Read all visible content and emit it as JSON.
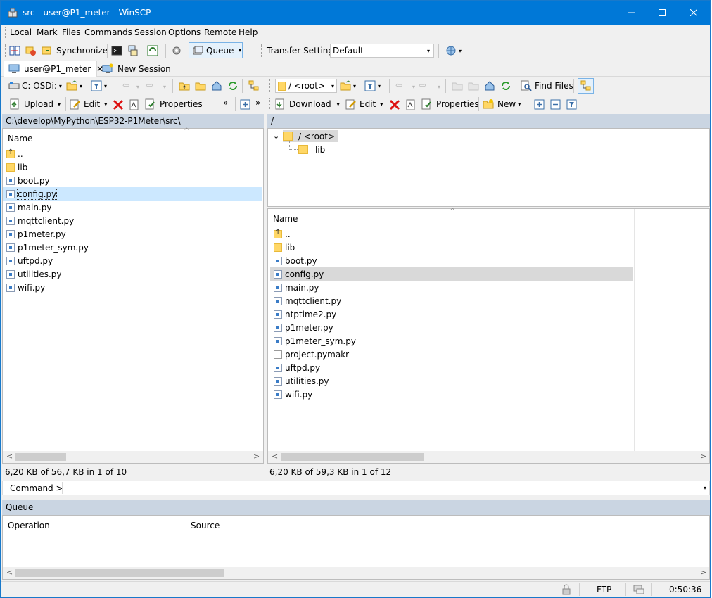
{
  "window": {
    "title": "src - user@P1_meter - WinSCP"
  },
  "menu": [
    "Local",
    "Mark",
    "Files",
    "Commands",
    "Session",
    "Options",
    "Remote",
    "Help"
  ],
  "toolbar": {
    "synchronize": "Synchronize",
    "queue": "Queue",
    "transfer_settings_label": "Transfer Settings",
    "transfer_settings_value": "Default"
  },
  "tabs": {
    "session": "user@P1_meter",
    "new_session": "New Session"
  },
  "local": {
    "drive": "C: OSDi:",
    "upload": "Upload",
    "edit": "Edit",
    "properties": "Properties",
    "path": "C:\\develop\\MyPython\\ESP32-P1Meter\\src\\",
    "name_header": "Name",
    "files": [
      {
        "name": "..",
        "kind": "updir"
      },
      {
        "name": "lib",
        "kind": "folder"
      },
      {
        "name": "boot.py",
        "kind": "py"
      },
      {
        "name": "config.py",
        "kind": "py"
      },
      {
        "name": "main.py",
        "kind": "py"
      },
      {
        "name": "mqttclient.py",
        "kind": "py"
      },
      {
        "name": "p1meter.py",
        "kind": "py"
      },
      {
        "name": "p1meter_sym.py",
        "kind": "py"
      },
      {
        "name": "uftpd.py",
        "kind": "py"
      },
      {
        "name": "utilities.py",
        "kind": "py"
      },
      {
        "name": "wifi.py",
        "kind": "py"
      }
    ],
    "status": "6,20 KB of 56,7 KB in 1 of 10"
  },
  "remote": {
    "location": "/ <root>",
    "find_files": "Find Files",
    "download": "Download",
    "edit": "Edit",
    "properties": "Properties",
    "new": "New",
    "path": "/",
    "tree_root": "/ <root>",
    "tree_child": "lib",
    "name_header": "Name",
    "files": [
      {
        "name": "..",
        "kind": "updir"
      },
      {
        "name": "lib",
        "kind": "folder"
      },
      {
        "name": "boot.py",
        "kind": "py"
      },
      {
        "name": "config.py",
        "kind": "py"
      },
      {
        "name": "main.py",
        "kind": "py"
      },
      {
        "name": "mqttclient.py",
        "kind": "py"
      },
      {
        "name": "ntptime2.py",
        "kind": "py"
      },
      {
        "name": "p1meter.py",
        "kind": "py"
      },
      {
        "name": "p1meter_sym.py",
        "kind": "py"
      },
      {
        "name": "project.pymakr",
        "kind": "plain"
      },
      {
        "name": "uftpd.py",
        "kind": "py"
      },
      {
        "name": "utilities.py",
        "kind": "py"
      },
      {
        "name": "wifi.py",
        "kind": "py"
      }
    ],
    "status": "6,20 KB of 59,3 KB in 1 of 12"
  },
  "command": {
    "label": "Command >"
  },
  "queue": {
    "title": "Queue",
    "col_operation": "Operation",
    "col_source": "Source"
  },
  "statusbar": {
    "protocol": "FTP",
    "time": "0:50:36"
  },
  "colors": {
    "titlebar": "#0078d7",
    "pathbar": "#cad5e2",
    "selection": "#cce8ff"
  }
}
